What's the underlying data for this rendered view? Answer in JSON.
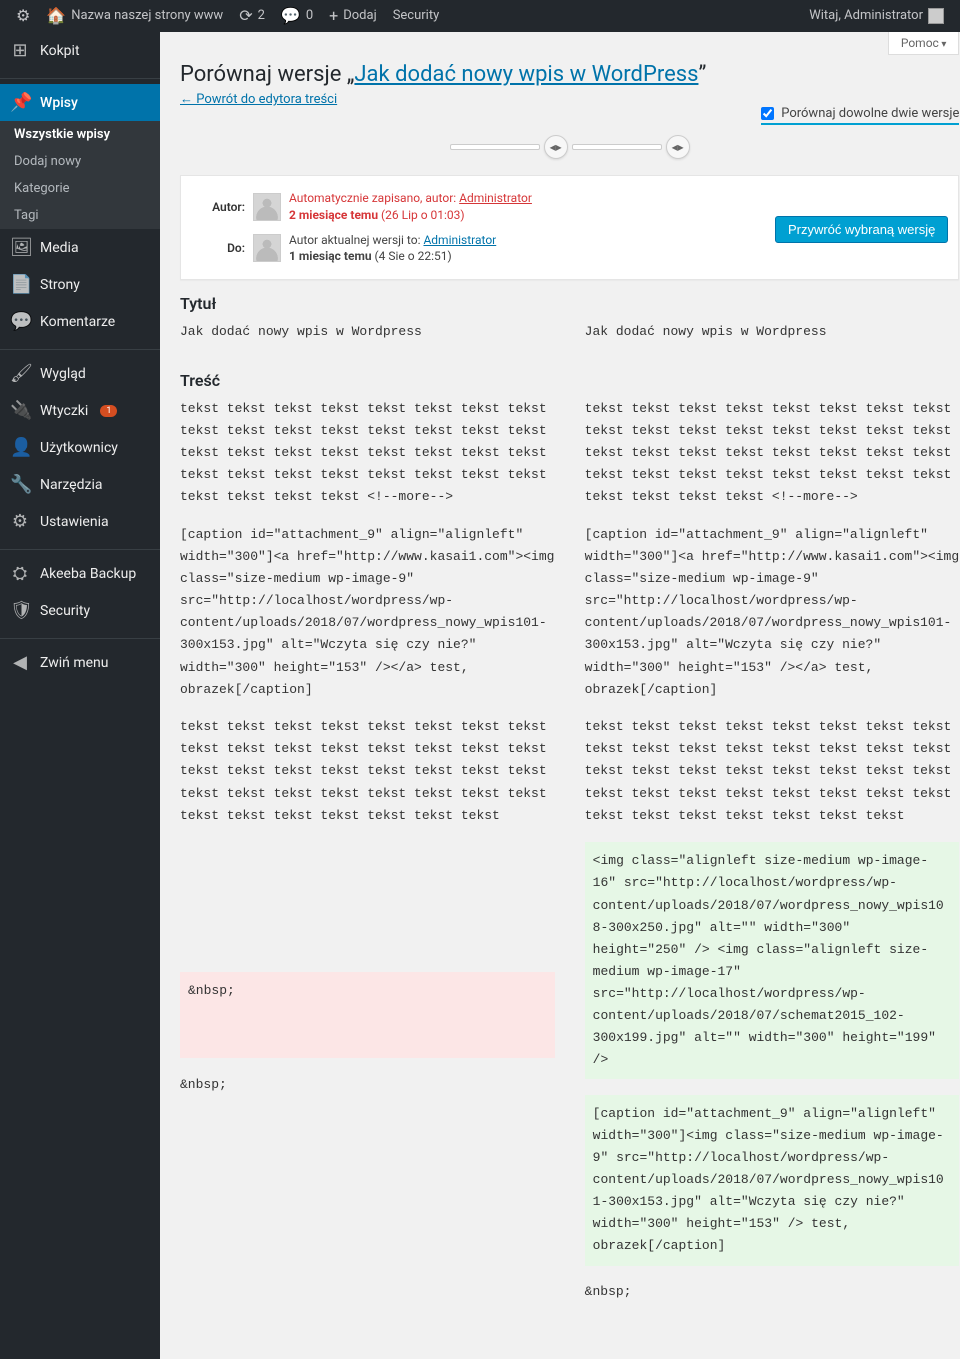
{
  "adminbar": {
    "site_name": "Nazwa naszej strony www",
    "updates": "2",
    "comments": "0",
    "add_new": "Dodaj",
    "security": "Security",
    "greeting": "Witaj, Administrator"
  },
  "sidebar": {
    "dashboard": "Kokpit",
    "posts": "Wpisy",
    "posts_sub": {
      "all": "Wszystkie wpisy",
      "add": "Dodaj nowy",
      "categories": "Kategorie",
      "tags": "Tagi"
    },
    "media": "Media",
    "pages": "Strony",
    "comments": "Komentarze",
    "appearance": "Wygląd",
    "plugins": "Wtyczki",
    "plugins_count": "1",
    "users": "Użytkownicy",
    "tools": "Narzędzia",
    "settings": "Ustawienia",
    "akeeba": "Akeeba Backup",
    "security": "Security",
    "collapse": "Zwiń menu"
  },
  "content": {
    "help": "Pomoc",
    "title_prefix": "Porównaj wersje „",
    "title_link": "Jak dodać nowy wpis w WordPress",
    "title_suffix": "”",
    "back": "← Powrót do edytora treści",
    "compare_any": "Porównaj dowolne dwie wersje",
    "meta": {
      "author_label": "Autor:",
      "to_label": "Do:",
      "from_line1": "Automatycznie zapisano, autor: ",
      "from_author": "Administrator",
      "from_line2": "2 miesiące temu",
      "from_date": " (26 Lip o 01:03)",
      "to_line1": "Autor aktualnej wersji to: ",
      "to_author": "Administrator",
      "to_line2": "1 miesiąc temu",
      "to_date": " (4 Sie o 22:51)",
      "restore": "Przywróć wybraną wersję"
    },
    "diff": {
      "title_heading": "Tytuł",
      "title_left": "Jak dodać nowy wpis w Wordpress",
      "title_right": "Jak dodać nowy wpis w Wordpress",
      "content_heading": "Treść",
      "left": {
        "p1": "tekst tekst tekst tekst tekst tekst tekst tekst tekst tekst tekst tekst tekst tekst tekst tekst tekst tekst tekst tekst tekst tekst tekst tekst tekst tekst tekst tekst tekst tekst tekst tekst tekst tekst tekst tekst <!--more-->",
        "p2": "[caption id=\"attachment_9\" align=\"alignleft\" width=\"300\"]<a href=\"http://www.kasai1.com\"><img class=\"size-medium wp-image-9\" src=\"http://localhost/wordpress/wp-content/uploads/2018/07/wordpress_nowy_wpis101-300x153.jpg\" alt=\"Wczyta się czy nie?\" width=\"300\" height=\"153\" /></a> test, obrazek[/caption]",
        "p3": "tekst tekst tekst tekst tekst tekst tekst tekst tekst tekst tekst tekst tekst tekst tekst tekst tekst tekst tekst tekst tekst tekst tekst tekst tekst tekst tekst tekst tekst tekst tekst tekst tekst tekst tekst tekst tekst tekst tekst",
        "p4": "&nbsp;",
        "p5": "&nbsp;"
      },
      "right": {
        "p1": "tekst tekst tekst tekst tekst tekst tekst tekst tekst tekst tekst tekst tekst tekst tekst tekst tekst tekst tekst tekst tekst tekst tekst tekst tekst tekst tekst tekst tekst tekst tekst tekst tekst tekst tekst tekst <!--more-->",
        "p2": "[caption id=\"attachment_9\" align=\"alignleft\" width=\"300\"]<a href=\"http://www.kasai1.com\"><img class=\"size-medium wp-image-9\" src=\"http://localhost/wordpress/wp-content/uploads/2018/07/wordpress_nowy_wpis101-300x153.jpg\" alt=\"Wczyta się czy nie?\" width=\"300\" height=\"153\" /></a> test, obrazek[/caption]",
        "p3": "tekst tekst tekst tekst tekst tekst tekst tekst tekst tekst tekst tekst tekst tekst tekst tekst tekst tekst tekst tekst tekst tekst tekst tekst tekst tekst tekst tekst tekst tekst tekst tekst tekst tekst tekst tekst tekst tekst tekst",
        "p4": "<img class=\"alignleft size-medium wp-image-16\" src=\"http://localhost/wordpress/wp-content/uploads/2018/07/wordpress_nowy_wpis108-300x250.jpg\" alt=\"\" width=\"300\" height=\"250\" /> <img class=\"alignleft size-medium wp-image-17\" src=\"http://localhost/wordpress/wp-content/uploads/2018/07/schemat2015_102-300x199.jpg\" alt=\"\" width=\"300\" height=\"199\" />",
        "p5": "[caption id=\"attachment_9\" align=\"alignleft\" width=\"300\"]<img class=\"size-medium wp-image-9\" src=\"http://localhost/wordpress/wp-content/uploads/2018/07/wordpress_nowy_wpis101-300x153.jpg\" alt=\"Wczyta się czy nie?\" width=\"300\" height=\"153\" /> test, obrazek[/caption]",
        "p6": "&nbsp;"
      }
    }
  }
}
